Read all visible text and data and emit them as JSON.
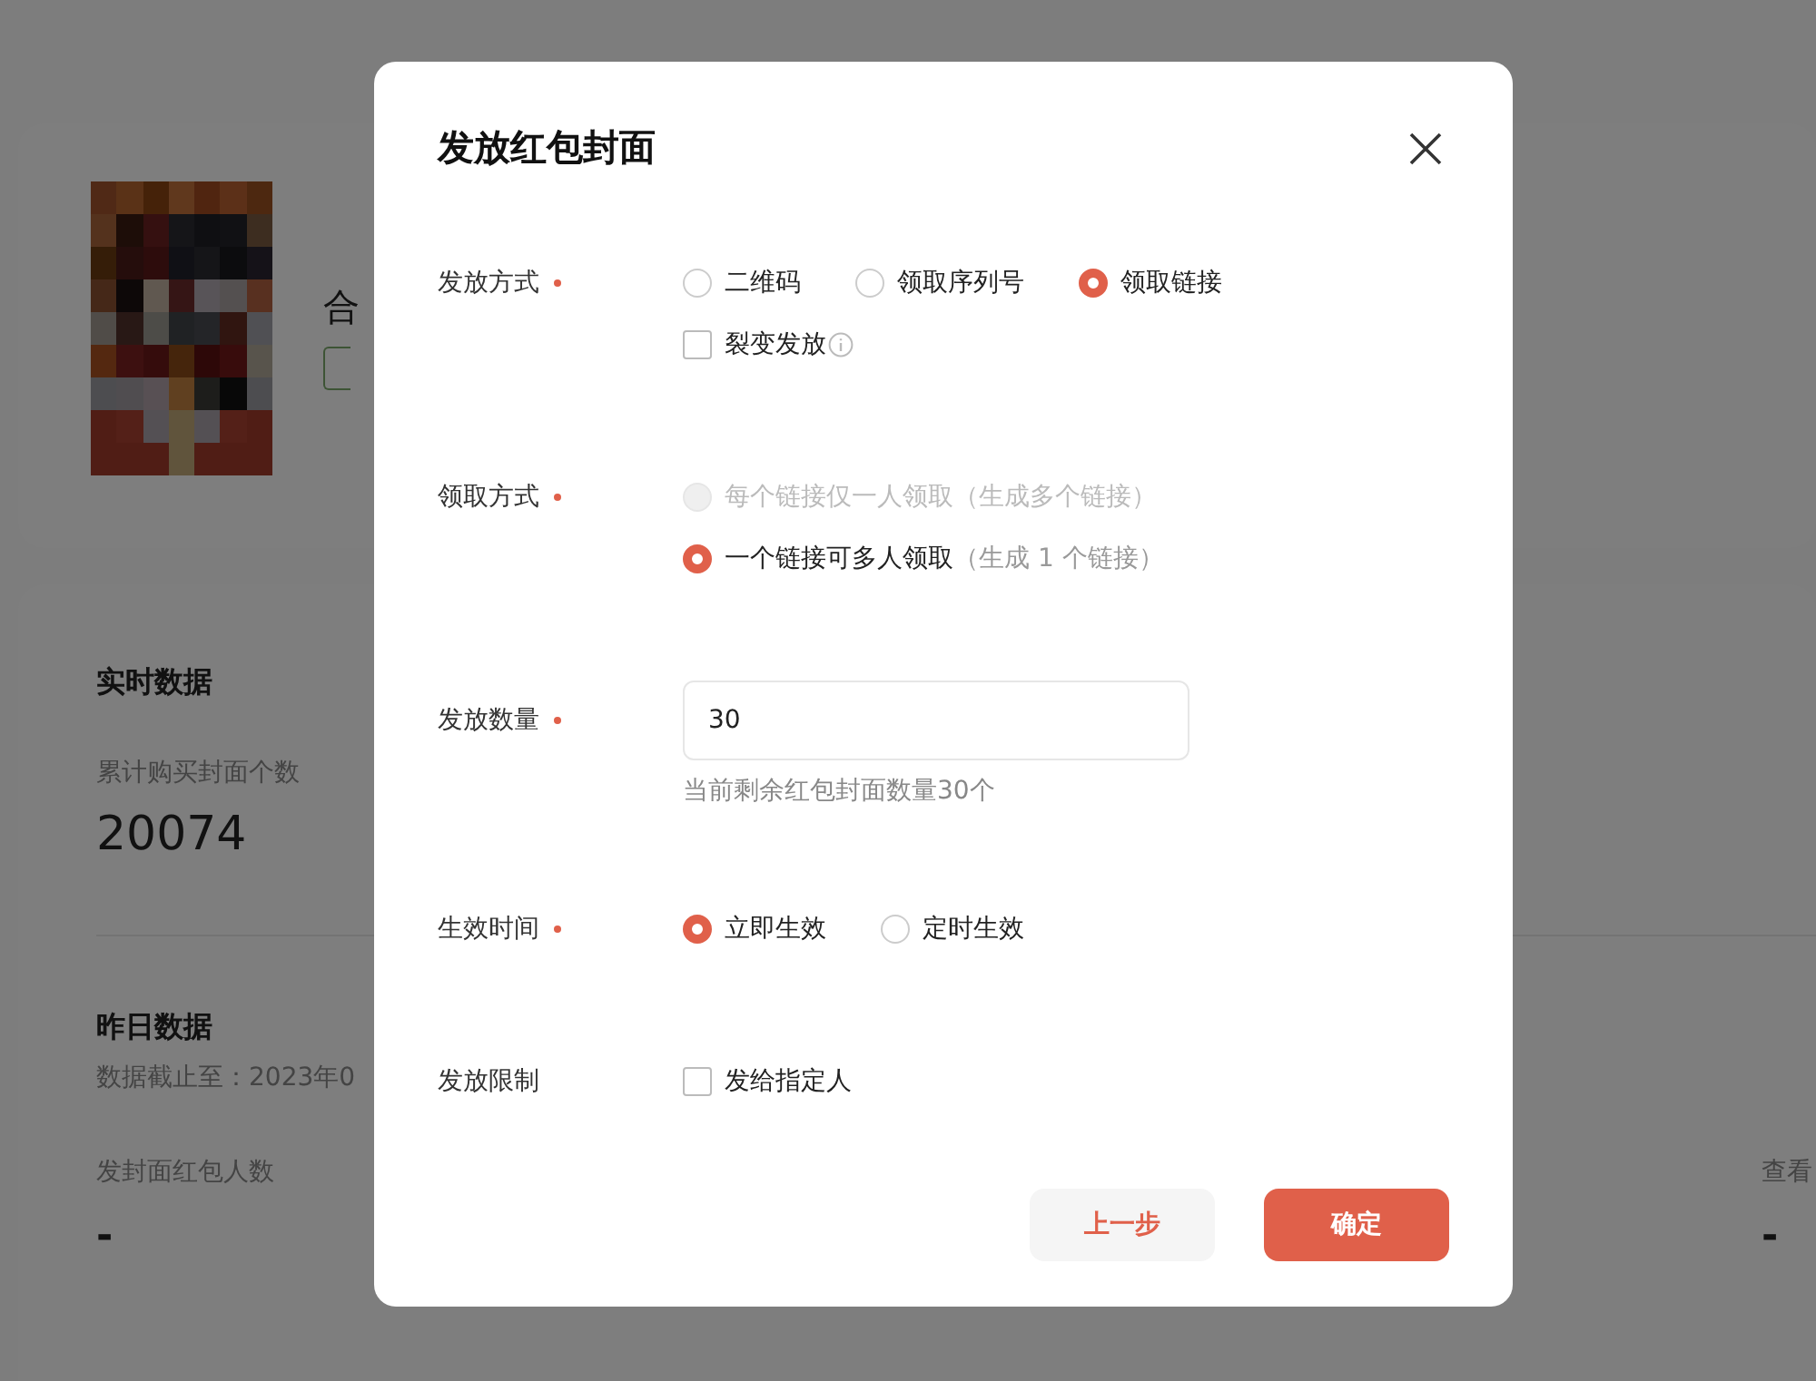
{
  "page": {
    "profile": {
      "name": "合"
    },
    "realtime": {
      "title": "实时数据",
      "metric_label": "累计购买封面个数",
      "metric_value": "20074"
    },
    "yesterday": {
      "title": "昨日数据",
      "cutoff": "数据截止至：2023年0",
      "metrics": [
        {
          "label": "发封面红包人数",
          "value": "-"
        },
        {
          "label": "查看",
          "value": "-"
        }
      ]
    }
  },
  "dialog": {
    "title": "发放红包封面",
    "fields": [
      {
        "kind": "radio",
        "label": "发放方式",
        "required": true,
        "options": [
          {
            "label": "二维码",
            "selected": false
          },
          {
            "label": "领取序列号",
            "selected": false
          },
          {
            "label": "领取链接",
            "selected": true
          }
        ],
        "checkboxes": [
          {
            "label": "裂变发放",
            "checked": false,
            "info": true
          }
        ]
      },
      {
        "kind": "radio-stack",
        "label": "领取方式",
        "required": true,
        "options": [
          {
            "label": "每个链接仅一人领取",
            "note": "（生成多个链接）",
            "selected": false,
            "disabled": true
          },
          {
            "label": "一个链接可多人领取",
            "note": "（生成 1 个链接）",
            "selected": true,
            "disabled": false
          }
        ]
      },
      {
        "kind": "input",
        "label": "发放数量",
        "required": true,
        "value": "30",
        "hint": "当前剩余红包封面数量30个"
      },
      {
        "kind": "radio",
        "label": "生效时间",
        "required": true,
        "options": [
          {
            "label": "立即生效",
            "selected": true
          },
          {
            "label": "定时生效",
            "selected": false
          }
        ]
      },
      {
        "kind": "checkbox",
        "label": "发放限制",
        "required": false,
        "checkboxes": [
          {
            "label": "发给指定人",
            "checked": false,
            "info": false
          }
        ]
      }
    ],
    "buttons": [
      {
        "label": "上一步",
        "kind": "secondary"
      },
      {
        "label": "确定",
        "kind": "primary"
      }
    ]
  }
}
